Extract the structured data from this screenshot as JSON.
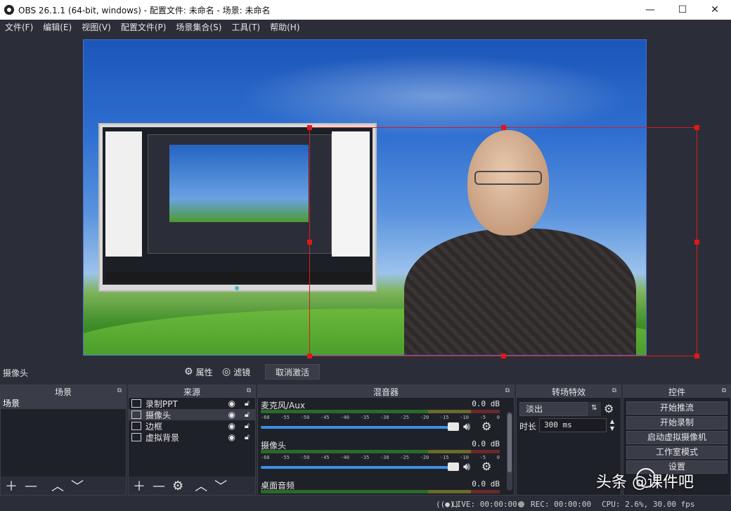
{
  "window": {
    "title": "OBS 26.1.1 (64-bit, windows) - 配置文件: 未命名 - 场景: 未命名",
    "minimize": "—",
    "maximize": "☐",
    "close": "✕"
  },
  "menu": [
    "文件(F)",
    "编辑(E)",
    "视图(V)",
    "配置文件(P)",
    "场景集合(S)",
    "工具(T)",
    "帮助(H)"
  ],
  "source_toolbar": {
    "selected_source": "摄像头",
    "properties_label": "属性",
    "filters_label": "滤镜",
    "deactivate_label": "取消激活"
  },
  "scenes": {
    "title": "场景",
    "items": [
      "场景"
    ]
  },
  "sources": {
    "title": "来源",
    "items": [
      {
        "label": "录制PPT",
        "icon": "monitor-icon"
      },
      {
        "label": "摄像头",
        "icon": "camera-icon"
      },
      {
        "label": "边框",
        "icon": "image-icon"
      },
      {
        "label": "虚拟背景",
        "icon": "image-icon"
      }
    ]
  },
  "mixer": {
    "title": "混音器",
    "tracks": [
      {
        "name": "麦克风/Aux",
        "db": "0.0 dB"
      },
      {
        "name": "摄像头",
        "db": "0.0 dB"
      },
      {
        "name": "桌面音频",
        "db": "0.0 dB"
      }
    ],
    "ticks": [
      "-60",
      "-55",
      "-50",
      "-45",
      "-40",
      "-35",
      "-30",
      "-25",
      "-20",
      "-15",
      "-10",
      "-5",
      "0"
    ]
  },
  "transitions": {
    "title": "转场特效",
    "selected": "淡出",
    "duration_label": "时长",
    "duration_value": "300 ms"
  },
  "controls": {
    "title": "控件",
    "buttons": [
      "开始推流",
      "开始录制",
      "启动虚拟摄像机",
      "工作室模式",
      "设置"
    ]
  },
  "status": {
    "live": "LIVE: 00:00:00",
    "rec": "REC: 00:00:00",
    "cpu": "CPU: 2.6%, 30.00 fps"
  },
  "watermark": "头条 @课件吧",
  "colors": {
    "selection": "#e01818",
    "background": "#2b2e38",
    "accent": "#3d8ee6"
  }
}
